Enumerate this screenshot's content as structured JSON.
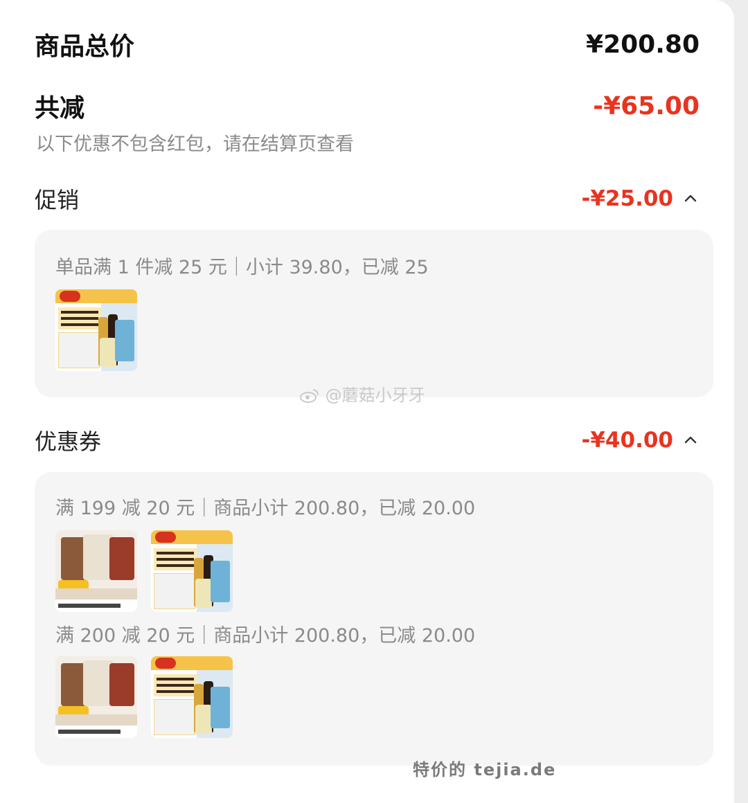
{
  "summary": {
    "total_label": "商品总价",
    "total_value": "¥200.80",
    "discount_label": "共减",
    "discount_value": "-¥65.00",
    "note": "以下优惠不包含红包，请在结算页查看"
  },
  "promotion": {
    "label": "促销",
    "value": "-¥25.00",
    "rules": [
      {
        "text": "单品满 1 件减 25 元｜小计 39.80，已减 25",
        "items": [
          "cooking-oil-set"
        ]
      }
    ]
  },
  "coupon": {
    "label": "优惠券",
    "value": "-¥40.00",
    "rules": [
      {
        "text": "满 199 减 20 元｜商品小计 200.80，已减 20.00",
        "items": [
          "beef-snack-pack",
          "cooking-oil-set"
        ]
      },
      {
        "text": "满 200 减 20 元｜商品小计 200.80，已减 20.00",
        "items": [
          "beef-snack-pack",
          "cooking-oil-set"
        ]
      }
    ]
  },
  "overlay": {
    "watermark": "@蘑菇小牙牙",
    "footer": "特价的 tejia.de"
  },
  "colors": {
    "accent_red": "#e8341f",
    "muted_text": "#8a8a8a",
    "panel_bg": "#f5f5f5"
  },
  "icons": [
    "chevron-up-icon",
    "weibo-icon"
  ]
}
